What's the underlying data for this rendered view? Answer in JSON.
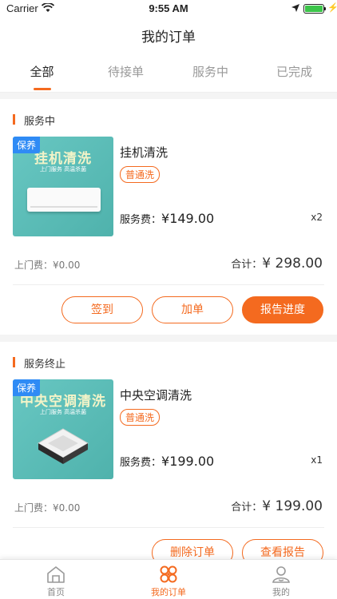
{
  "status_bar": {
    "carrier": "Carrier",
    "time": "9:55 AM"
  },
  "header": {
    "title": "我的订单"
  },
  "tabs": [
    {
      "label": "全部",
      "active": true
    },
    {
      "label": "待接单",
      "active": false
    },
    {
      "label": "服务中",
      "active": false
    },
    {
      "label": "已完成",
      "active": false
    }
  ],
  "orders": [
    {
      "status": "服务中",
      "image": {
        "badge": "保养",
        "title": "挂机清洗",
        "subtitle": "上门服务 高温杀菌"
      },
      "name": "挂机清洗",
      "tag": "普通洗",
      "fee_label": "服务费：",
      "fee": "¥149.00",
      "qty": "x2",
      "visit_fee": "上门费：¥0.00",
      "total_label": "合计：",
      "total": "¥ 298.00",
      "buttons": [
        "签到",
        "加单",
        "报告进度"
      ]
    },
    {
      "status": "服务终止",
      "image": {
        "badge": "保养",
        "title": "中央空调清洗",
        "subtitle": "上门服务 高温杀菌"
      },
      "name": "中央空调清洗",
      "tag": "普通洗",
      "fee_label": "服务费：",
      "fee": "¥199.00",
      "qty": "x1",
      "visit_fee": "上门费：¥0.00",
      "total_label": "合计：",
      "total": "¥ 199.00",
      "buttons": [
        "删除订单",
        "查看报告"
      ]
    }
  ],
  "tabbar": [
    {
      "label": "首页",
      "icon": "home-icon",
      "active": false
    },
    {
      "label": "我的订单",
      "icon": "orders-icon",
      "active": true
    },
    {
      "label": "我的",
      "icon": "profile-icon",
      "active": false
    }
  ],
  "colors": {
    "accent": "#f46a1f",
    "badge": "#2f8bf5",
    "battery": "#3cc54a"
  }
}
